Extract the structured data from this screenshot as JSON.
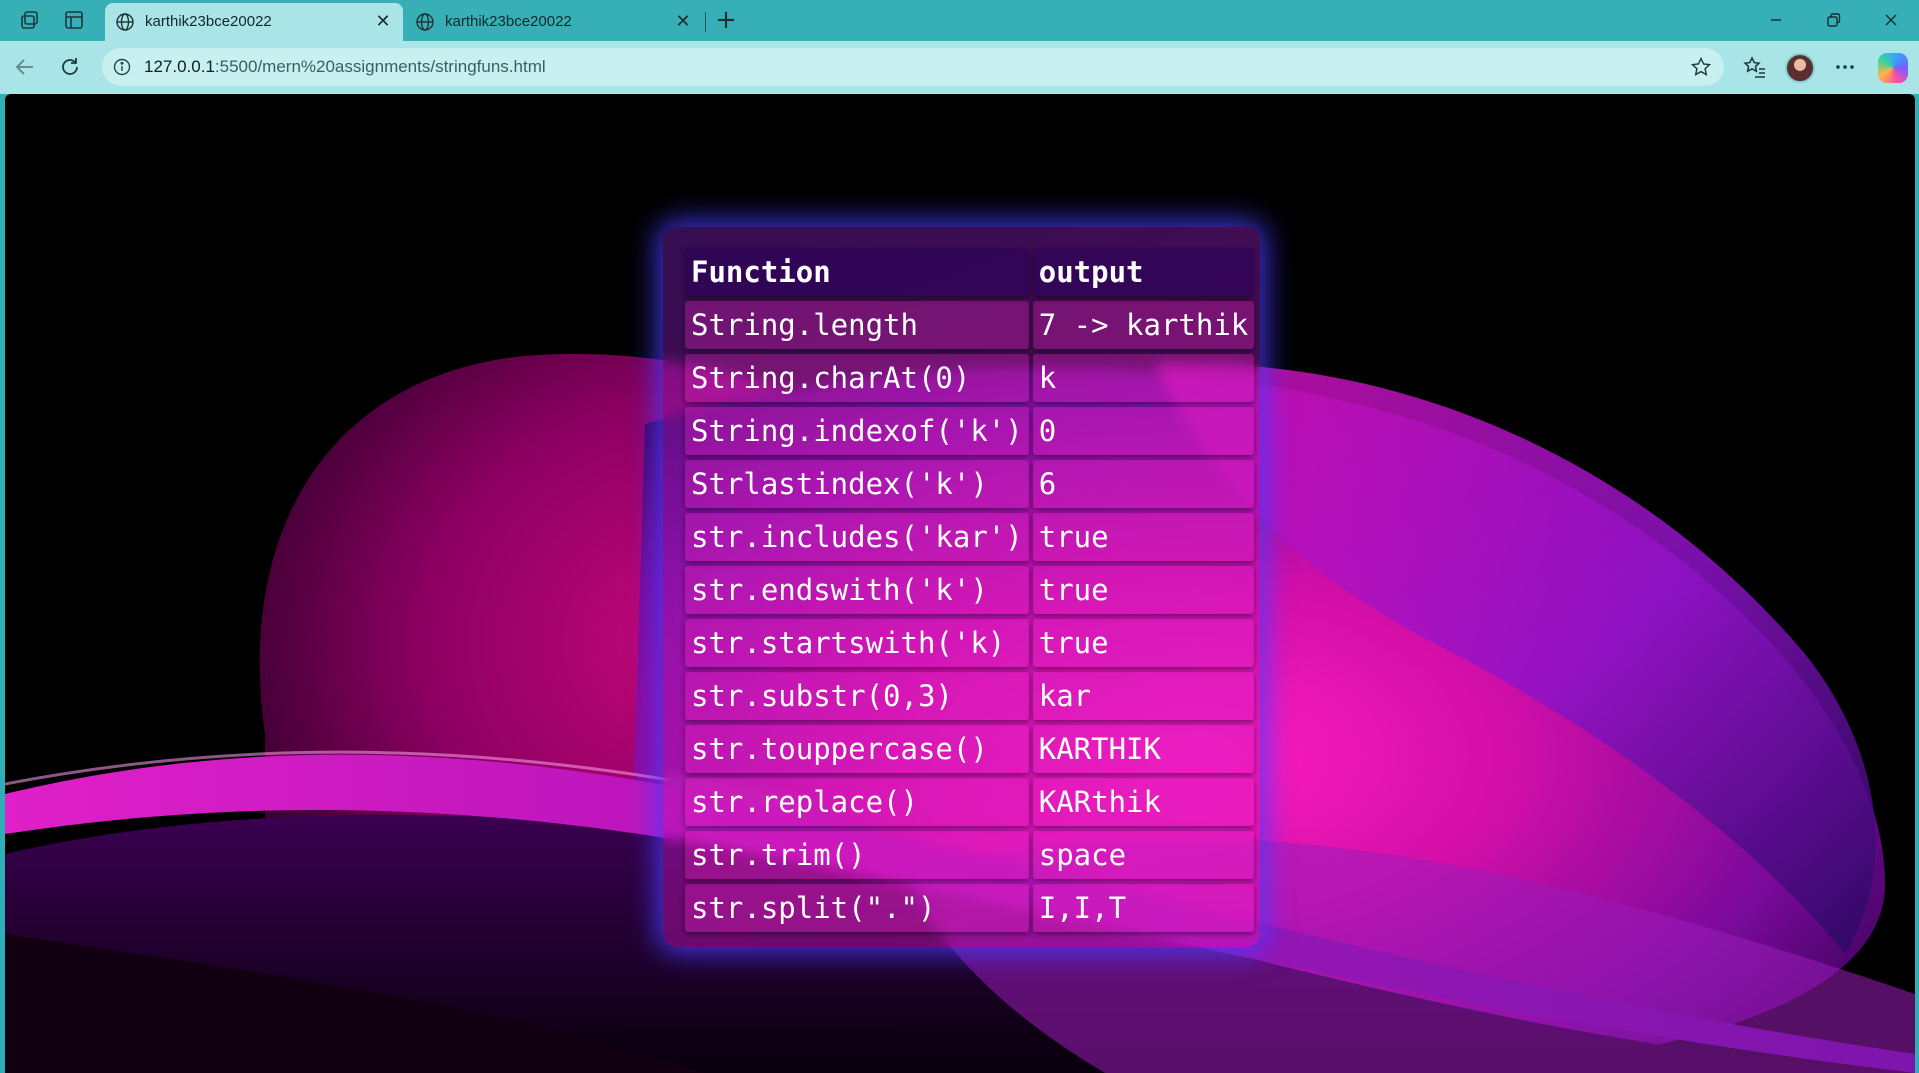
{
  "browser": {
    "tabs": [
      {
        "title": "karthik23bce20022",
        "active": true
      },
      {
        "title": "karthik23bce20022",
        "active": false
      }
    ],
    "url": {
      "host": "127.0.0.1",
      "path": ":5500/mern%20assignments/stringfuns.html"
    }
  },
  "table": {
    "headers": {
      "function": "Function",
      "output": "output"
    },
    "rows": [
      {
        "function": "String.length",
        "output": "7 -> karthik"
      },
      {
        "function": "String.charAt(0)",
        "output": "k"
      },
      {
        "function": "String.indexof('k')",
        "output": "0"
      },
      {
        "function": "Strlastindex('k')",
        "output": "6"
      },
      {
        "function": "str.includes('kar')",
        "output": "true"
      },
      {
        "function": "str.endswith('k')",
        "output": "true"
      },
      {
        "function": "str.startswith('k)",
        "output": "true"
      },
      {
        "function": "str.substr(0,3)",
        "output": "kar"
      },
      {
        "function": "str.touppercase()",
        "output": "KARTHIK"
      },
      {
        "function": "str.replace()",
        "output": "KARthik"
      },
      {
        "function": "str.trim()",
        "output": "space"
      },
      {
        "function": "str.split(\".\")",
        "output": "I,I,T"
      }
    ]
  },
  "icons": [
    "workspaces-icon",
    "tab-actions-icon",
    "globe-icon",
    "close-icon",
    "new-tab-icon",
    "minimize-icon",
    "restore-icon",
    "window-close-icon",
    "back-icon",
    "refresh-icon",
    "info-icon",
    "favorite-star-icon",
    "favorites-icon",
    "profile-avatar",
    "more-icon",
    "copilot-icon"
  ]
}
